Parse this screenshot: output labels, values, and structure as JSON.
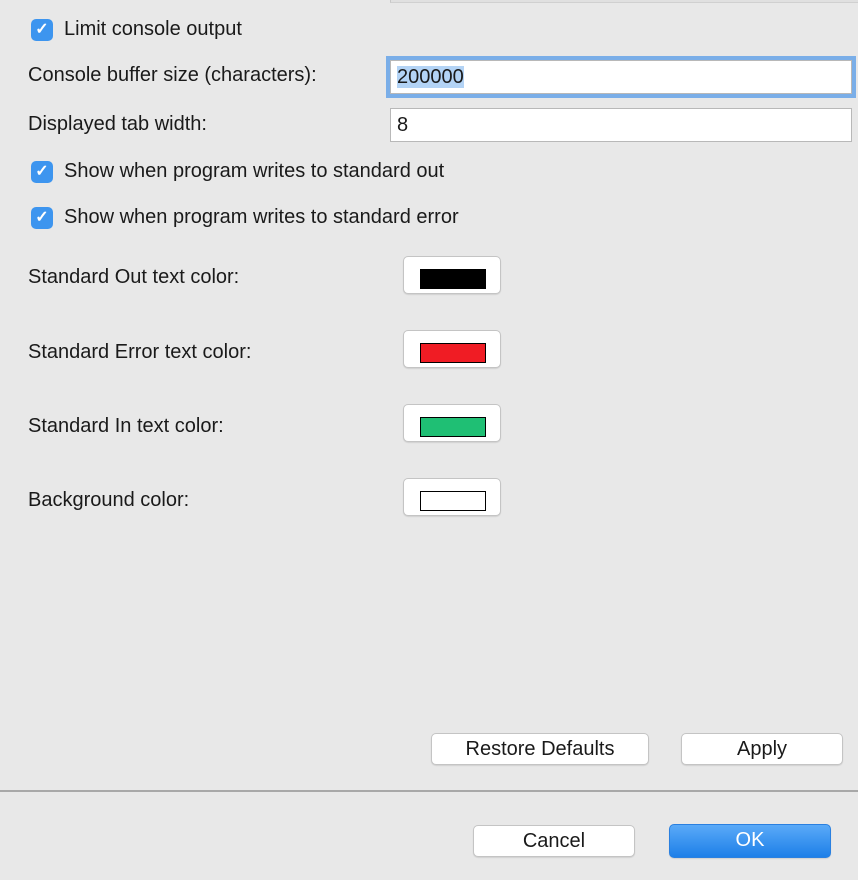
{
  "limit_output": {
    "label": "Limit console output",
    "checked": true
  },
  "buffer": {
    "label": "Console buffer size (characters):",
    "value": "200000"
  },
  "tab_width": {
    "label": "Displayed tab width:",
    "value": "8"
  },
  "show_stdout": {
    "label": "Show when program writes to standard out",
    "checked": true
  },
  "show_stderr": {
    "label": "Show when program writes to standard error",
    "checked": true
  },
  "colors": [
    {
      "label": "Standard Out text color:",
      "color": "#000000"
    },
    {
      "label": "Standard Error text color:",
      "color": "#f01c24"
    },
    {
      "label": "Standard In text color:",
      "color": "#1fbf74"
    },
    {
      "label": "Background color:",
      "color": "#ffffff"
    }
  ],
  "buttons": {
    "restore": "Restore Defaults",
    "apply": "Apply",
    "cancel": "Cancel",
    "ok": "OK"
  },
  "check_glyph": "✓"
}
